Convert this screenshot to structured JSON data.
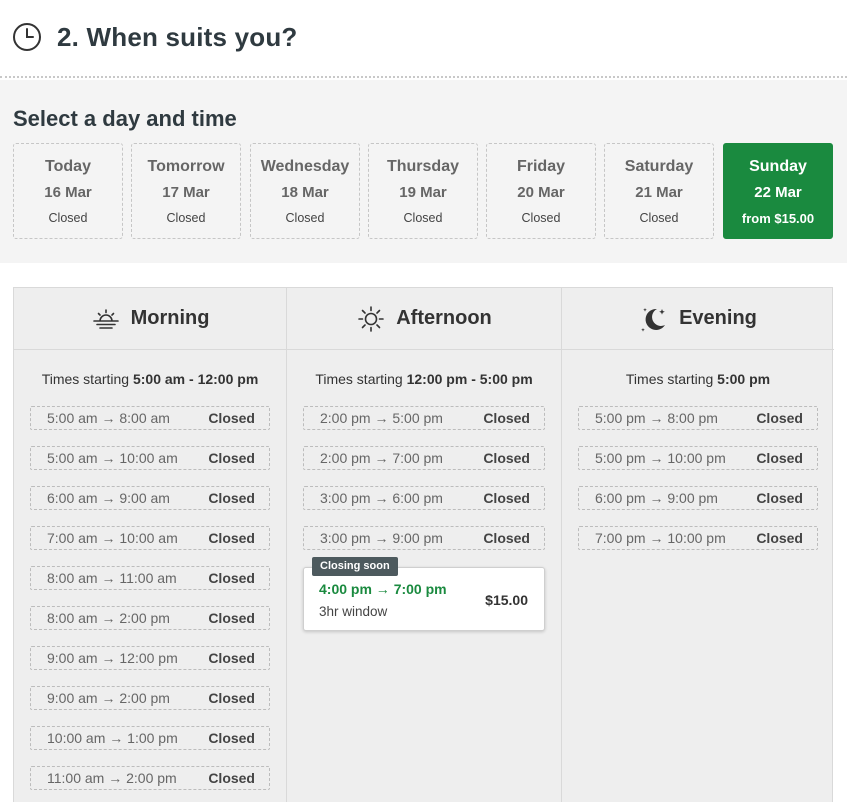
{
  "header": {
    "title": "2. When suits you?"
  },
  "day_section": {
    "subtitle": "Select a day and time",
    "days": [
      {
        "name": "Today",
        "date": "16 Mar",
        "status": "Closed"
      },
      {
        "name": "Tomorrow",
        "date": "17 Mar",
        "status": "Closed"
      },
      {
        "name": "Wednesday",
        "date": "18 Mar",
        "status": "Closed"
      },
      {
        "name": "Thursday",
        "date": "19 Mar",
        "status": "Closed"
      },
      {
        "name": "Friday",
        "date": "20 Mar",
        "status": "Closed"
      },
      {
        "name": "Saturday",
        "date": "21 Mar",
        "status": "Closed"
      },
      {
        "name": "Sunday",
        "date": "22 Mar",
        "status": "from $15.00",
        "selected": true
      }
    ]
  },
  "periods": [
    {
      "name": "Morning",
      "icon": "sunrise-icon",
      "range_prefix": "Times starting",
      "range": "5:00 am - 12:00 pm",
      "slots": [
        {
          "time": "5:00 am → 8:00 am",
          "status": "Closed"
        },
        {
          "time": "5:00 am → 10:00 am",
          "status": "Closed"
        },
        {
          "time": "6:00 am → 9:00 am",
          "status": "Closed"
        },
        {
          "time": "7:00 am → 10:00 am",
          "status": "Closed"
        },
        {
          "time": "8:00 am → 11:00 am",
          "status": "Closed"
        },
        {
          "time": "8:00 am → 2:00 pm",
          "status": "Closed"
        },
        {
          "time": "9:00 am → 12:00 pm",
          "status": "Closed"
        },
        {
          "time": "9:00 am → 2:00 pm",
          "status": "Closed"
        },
        {
          "time": "10:00 am → 1:00 pm",
          "status": "Closed"
        },
        {
          "time": "11:00 am → 2:00 pm",
          "status": "Closed"
        }
      ]
    },
    {
      "name": "Afternoon",
      "icon": "sun-icon",
      "range_prefix": "Times starting",
      "range": "12:00 pm - 5:00 pm",
      "slots": [
        {
          "time": "2:00 pm → 5:00 pm",
          "status": "Closed"
        },
        {
          "time": "2:00 pm → 7:00 pm",
          "status": "Closed"
        },
        {
          "time": "3:00 pm → 6:00 pm",
          "status": "Closed"
        },
        {
          "time": "3:00 pm → 9:00 pm",
          "status": "Closed"
        }
      ],
      "available": {
        "badge": "Closing soon",
        "time": "4:00 pm → 7:00 pm",
        "window": "3hr window",
        "price": "$15.00"
      }
    },
    {
      "name": "Evening",
      "icon": "moon-icon",
      "range_prefix": "Times starting",
      "range": "5:00 pm",
      "slots": [
        {
          "time": "5:00 pm → 8:00 pm",
          "status": "Closed"
        },
        {
          "time": "5:00 pm → 10:00 pm",
          "status": "Closed"
        },
        {
          "time": "6:00 pm → 9:00 pm",
          "status": "Closed"
        },
        {
          "time": "7:00 pm → 10:00 pm",
          "status": "Closed"
        }
      ]
    }
  ],
  "colors": {
    "accent": "#1a8a3f",
    "badge": "#4d5a5e",
    "panel_bg": "#eeeeee"
  }
}
